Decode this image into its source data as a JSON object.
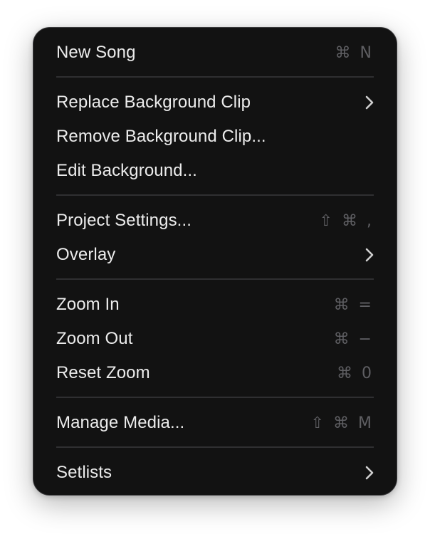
{
  "menu": {
    "items": {
      "new_song": {
        "label": "New Song",
        "shortcut": "⌘ N"
      },
      "replace_background_clip": {
        "label": "Replace Background Clip"
      },
      "remove_background_clip": {
        "label": "Remove Background Clip..."
      },
      "edit_background": {
        "label": "Edit Background..."
      },
      "project_settings": {
        "label": "Project Settings...",
        "shortcut": "⇧ ⌘ ,"
      },
      "overlay": {
        "label": "Overlay"
      },
      "zoom_in": {
        "label": "Zoom In",
        "shortcut": "⌘ ="
      },
      "zoom_out": {
        "label": "Zoom Out",
        "shortcut": "⌘ −"
      },
      "reset_zoom": {
        "label": "Reset Zoom",
        "shortcut": "⌘ 0"
      },
      "manage_media": {
        "label": "Manage Media...",
        "shortcut": "⇧ ⌘ M"
      },
      "setlists": {
        "label": "Setlists"
      }
    }
  },
  "colors": {
    "menu_background": "#121212",
    "label_text": "#ececec",
    "shortcut_text": "#5f5f63",
    "separator": "#2f2f31"
  },
  "icons": {
    "submenu": "chevron-right-icon"
  }
}
